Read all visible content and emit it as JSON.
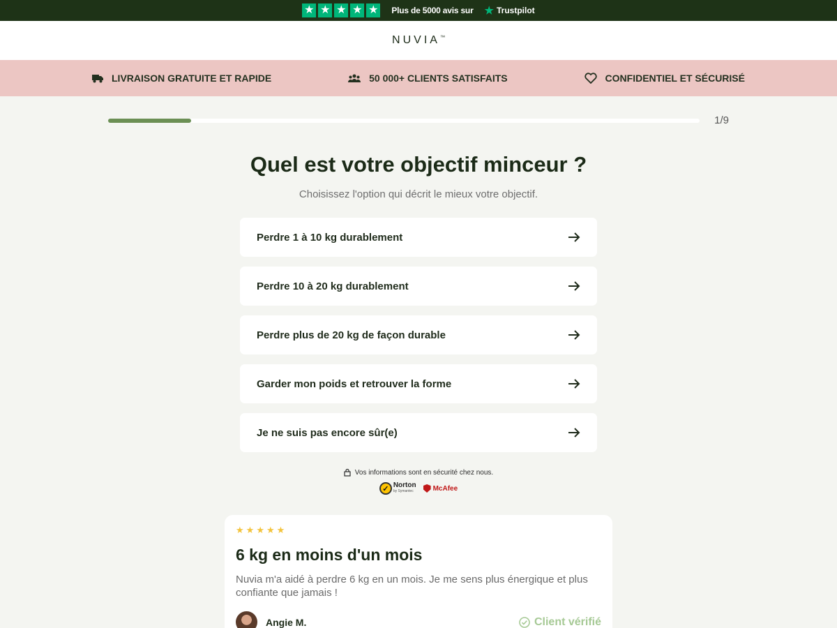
{
  "topbar": {
    "stars": [
      "★",
      "★",
      "★",
      "★",
      "★"
    ],
    "text": "Plus de 5000 avis sur",
    "brand": "Trustpilot"
  },
  "header": {
    "logo": "NUVIA",
    "tm": "™"
  },
  "benefits": [
    {
      "icon": "truck-icon",
      "label": "LIVRAISON GRATUITE ET RAPIDE"
    },
    {
      "icon": "users-icon",
      "label": "50 000+ CLIENTS SATISFAITS"
    },
    {
      "icon": "heart-icon",
      "label": "CONFIDENTIEL ET SÉCURISÉ"
    }
  ],
  "progress": {
    "fraction": 0.14,
    "label": "1/9",
    "color": "#6b8f54"
  },
  "question": {
    "title": "Quel est votre objectif minceur ?",
    "subtitle": "Choisissez l'option qui décrit le mieux votre objectif."
  },
  "options": [
    {
      "label": "Perdre 1 à 10 kg durablement"
    },
    {
      "label": "Perdre 10 à 20 kg durablement"
    },
    {
      "label": "Perdre plus de 20 kg de façon durable"
    },
    {
      "label": "Garder mon poids et retrouver la forme"
    },
    {
      "label": "Je ne suis pas encore sûr(e)"
    }
  ],
  "security": {
    "text": "Vos informations sont en sécurité chez nous.",
    "norton": "Norton",
    "norton_sub": "by Symantec",
    "mcafee": "McAfee"
  },
  "review": {
    "stars": [
      "★",
      "★",
      "★",
      "★",
      "★"
    ],
    "title": "6 kg en moins d'un mois",
    "text": "Nuvia m'a aidé à perdre 6 kg en un mois. Je me sens plus énergique et plus confiante que jamais !",
    "author": "Angie M.",
    "verified": "Client vérifié"
  },
  "colors": {
    "dark_green": "#1e3317",
    "pink": "#ecc6c3",
    "accent": "#6b8f54",
    "trustpilot": "#00b67a"
  }
}
